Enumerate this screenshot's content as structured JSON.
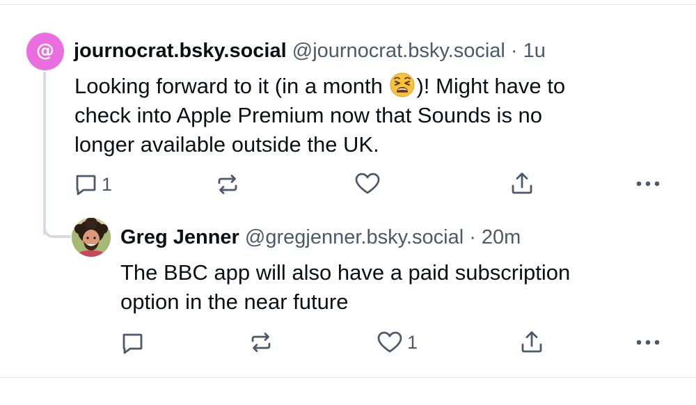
{
  "posts": [
    {
      "avatar_glyph": "@",
      "avatar_color": "#ea6ee0",
      "display_name": "journocrat.bsky.social",
      "handle_time": "@journocrat.bsky.social · 1u",
      "text_before_emoji": "Looking forward to it (in a month ",
      "emoji": "tired-face-emoji",
      "text_after_emoji": ")! Might have to",
      "text_line2": "check into Apple Premium now that Sounds is no",
      "text_line3": "longer available outside the UK.",
      "actions": {
        "reply_count": "1",
        "repost_count": "",
        "like_count": "",
        "icons": [
          "reply-icon",
          "repost-icon",
          "like-icon",
          "share-icon",
          "more-icon"
        ]
      }
    },
    {
      "display_name": "Greg Jenner",
      "handle_time": "@gregjenner.bsky.social · 20m",
      "text_line1": "The BBC app will also have a paid subscription",
      "text_line2": "option in the near future",
      "actions": {
        "reply_count": "",
        "repost_count": "",
        "like_count": "1",
        "icons": [
          "reply-icon",
          "repost-icon",
          "like-icon",
          "share-icon",
          "more-icon"
        ]
      }
    }
  ],
  "colors": {
    "text": "#0b0f14",
    "secondary": "#4b5968",
    "thread_line": "#d5dbe2",
    "divider": "#e5e7ea"
  }
}
